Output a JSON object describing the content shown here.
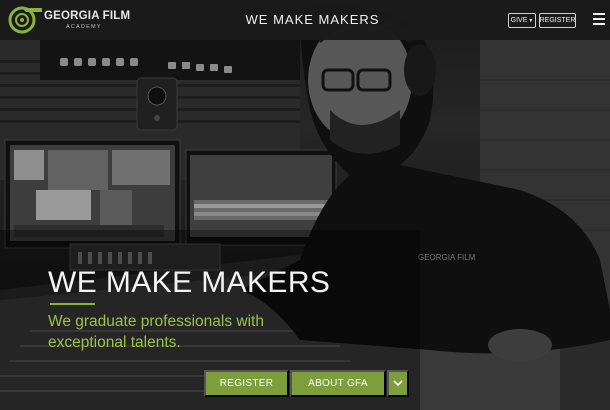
{
  "header": {
    "logo": {
      "title": "GEORGIA FILM",
      "subtitle": "ACADEMY",
      "registered": "®"
    },
    "site_title": "WE MAKE MAKERS",
    "give_label": "GIVE",
    "register_label": "REGISTER",
    "menu_icon": "hamburger-menu-icon"
  },
  "hero": {
    "heading": "WE MAKE MAKERS",
    "subheading": "We graduate professionals with exceptional talents.",
    "accent_color": "#8ab33a",
    "background": "grayscale photo of audio engineer at mixing console with monitors"
  },
  "cta": {
    "register_label": "REGISTER",
    "about_label": "ABOUT GFA",
    "toggle_icon": "chevron-down-icon",
    "button_color": "#7c9f3b"
  }
}
